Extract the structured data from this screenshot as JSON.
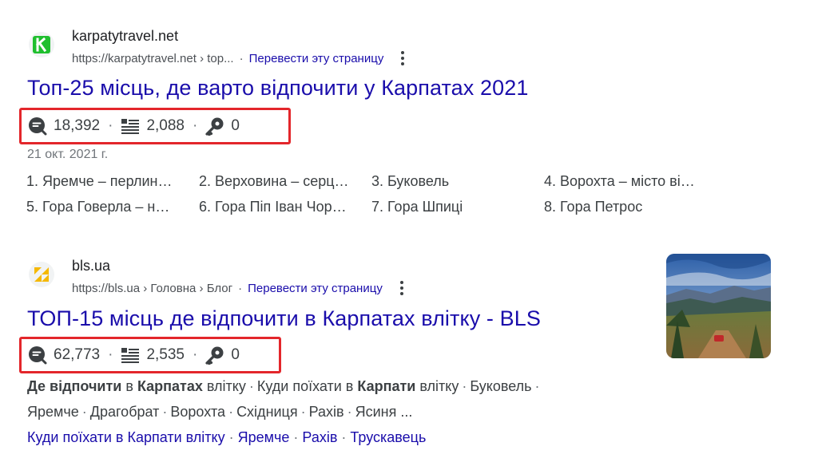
{
  "results": [
    {
      "site_name": "karpatytravel.net",
      "url": "https://karpatytravel.net › top...",
      "translate": "Перевести эту страницу",
      "title": "Топ-25 місць, де варто відпочити у Карпатах 2021",
      "metrics": {
        "traffic": "18,392",
        "words": "2,088",
        "keywords": "0"
      },
      "date": "21 окт. 2021 г.",
      "list_items": [
        "1. Яремче – перлин…",
        "2. Верховина – серц…",
        "3. Буковель",
        "4. Ворохта – місто ві…",
        "5. Гора Говерла – н…",
        "6. Гора Піп Іван Чор…",
        "7. Гора Шпиці",
        "8. Гора Петрос"
      ],
      "favicon_letter": "K",
      "favicon_color": "#1fbf2e"
    },
    {
      "site_name": "bls.ua",
      "url": "https://bls.ua › Головна › Блог",
      "translate": "Перевести эту страницу",
      "title": "ТОП-15 місць де відпочити в Карпатах влітку - BLS",
      "metrics": {
        "traffic": "62,773",
        "words": "2,535",
        "keywords": "0"
      },
      "snippet_line1": {
        "b1": "Де відпочити",
        "t1": " в ",
        "b2": "Карпатах",
        "t2": " влітку",
        "items": [
          "Куди поїхати в",
          "Буковель"
        ],
        "b3": "Карпати",
        "t3": " влітку"
      },
      "snippet_line2": [
        "Яремче",
        "Драгобрат",
        "Ворохта",
        "Східниця",
        "Рахів",
        "Ясиня ..."
      ],
      "sitelinks": [
        "Куди поїхати в Карпати влітку",
        "Яремче",
        "Рахів",
        "Трускавець"
      ],
      "favicon_color": "#f5b800"
    }
  ],
  "icons": {
    "traffic": "search-traffic-icon",
    "words": "word-count-icon",
    "keywords": "key-icon"
  },
  "colors": {
    "link": "#1a0dab",
    "highlight_border": "#e3262b",
    "text": "#202124"
  }
}
